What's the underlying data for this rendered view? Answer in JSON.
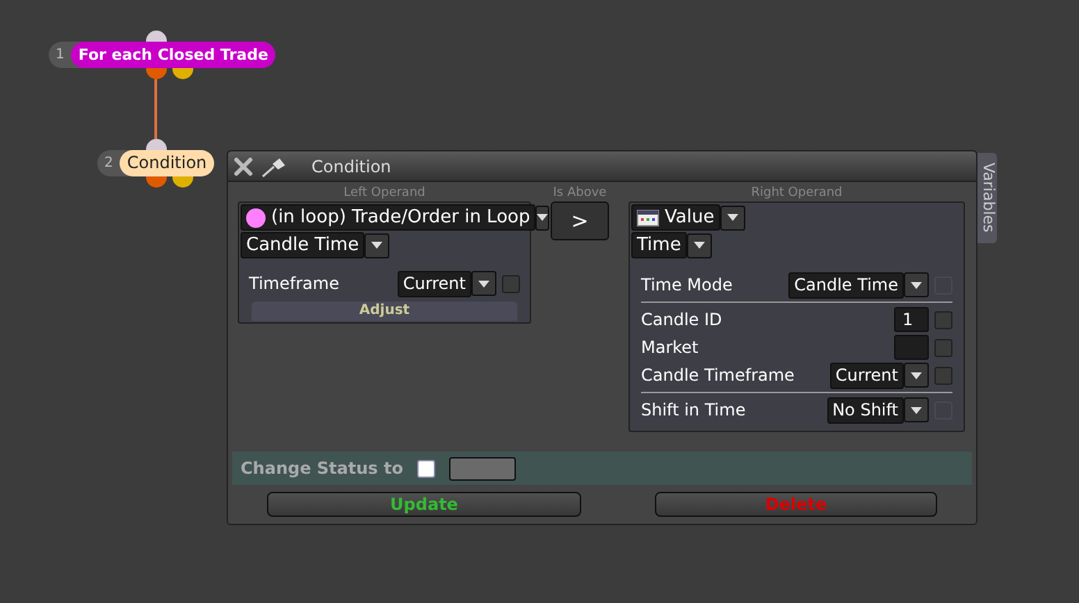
{
  "nodes": [
    {
      "number": "1",
      "label": "For each Closed Trade",
      "color": "#c800c8"
    },
    {
      "number": "2",
      "label": "Condition",
      "color": "#ffdcaa"
    }
  ],
  "dialog": {
    "title": "Condition",
    "left": {
      "heading": "Left Operand",
      "source": "(in loop) Trade/Order in Loop",
      "property": "Candle Time",
      "groups": [
        [
          {
            "label": "Timeframe",
            "kind": "dropdown",
            "value": "Current",
            "checked": false,
            "disabled": false
          }
        ]
      ],
      "button": "Adjust"
    },
    "operator": {
      "heading": "Is Above",
      "symbol": ">"
    },
    "right": {
      "heading": "Right Operand",
      "source": "Value",
      "property": "Time",
      "groups": [
        [
          {
            "label": "Time Mode",
            "kind": "dropdown",
            "value": "Candle Time",
            "checked": false,
            "disabled": true
          }
        ],
        [
          {
            "label": "Candle ID",
            "kind": "input",
            "value": "1",
            "checked": false,
            "disabled": false
          },
          {
            "label": "Market",
            "kind": "input",
            "checked": false,
            "disabled": false
          },
          {
            "label": "Candle Timeframe",
            "kind": "dropdown",
            "value": "Current",
            "checked": false,
            "disabled": false
          }
        ],
        [
          {
            "label": "Shift in Time",
            "kind": "dropdown",
            "value": "No Shift",
            "checked": false,
            "disabled": true
          }
        ]
      ]
    },
    "side_tab": "Variables",
    "status": {
      "label": "Change Status to",
      "checked": false
    },
    "buttons": [
      {
        "label": "Update",
        "kind": "update"
      },
      {
        "label": "Delete",
        "kind": "delete"
      }
    ]
  }
}
